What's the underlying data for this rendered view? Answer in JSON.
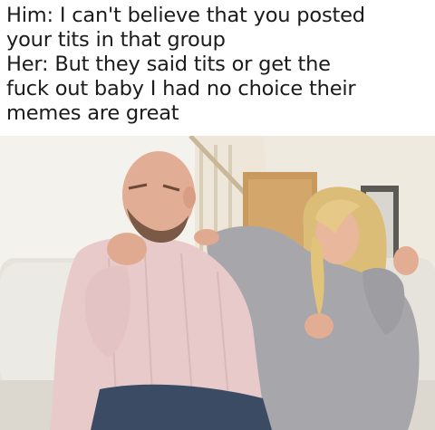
{
  "caption": {
    "lines": [
      "Him: I can't believe that you posted",
      "your tits in that group",
      "Her: But they said tits or get the",
      "fuck out baby I had no choice their",
      "memes are great"
    ]
  },
  "photo": {
    "description_icon": "couple-on-couch-photo",
    "colors": {
      "wall": "#e9e3d6",
      "door": "#c99a5e",
      "couch": "#e8e6e0",
      "man_shirt": "#e7c9c9",
      "woman_sweater": "#a9a8ad",
      "hair_blonde": "#e2c37a",
      "skin": "#e2ad92"
    }
  }
}
